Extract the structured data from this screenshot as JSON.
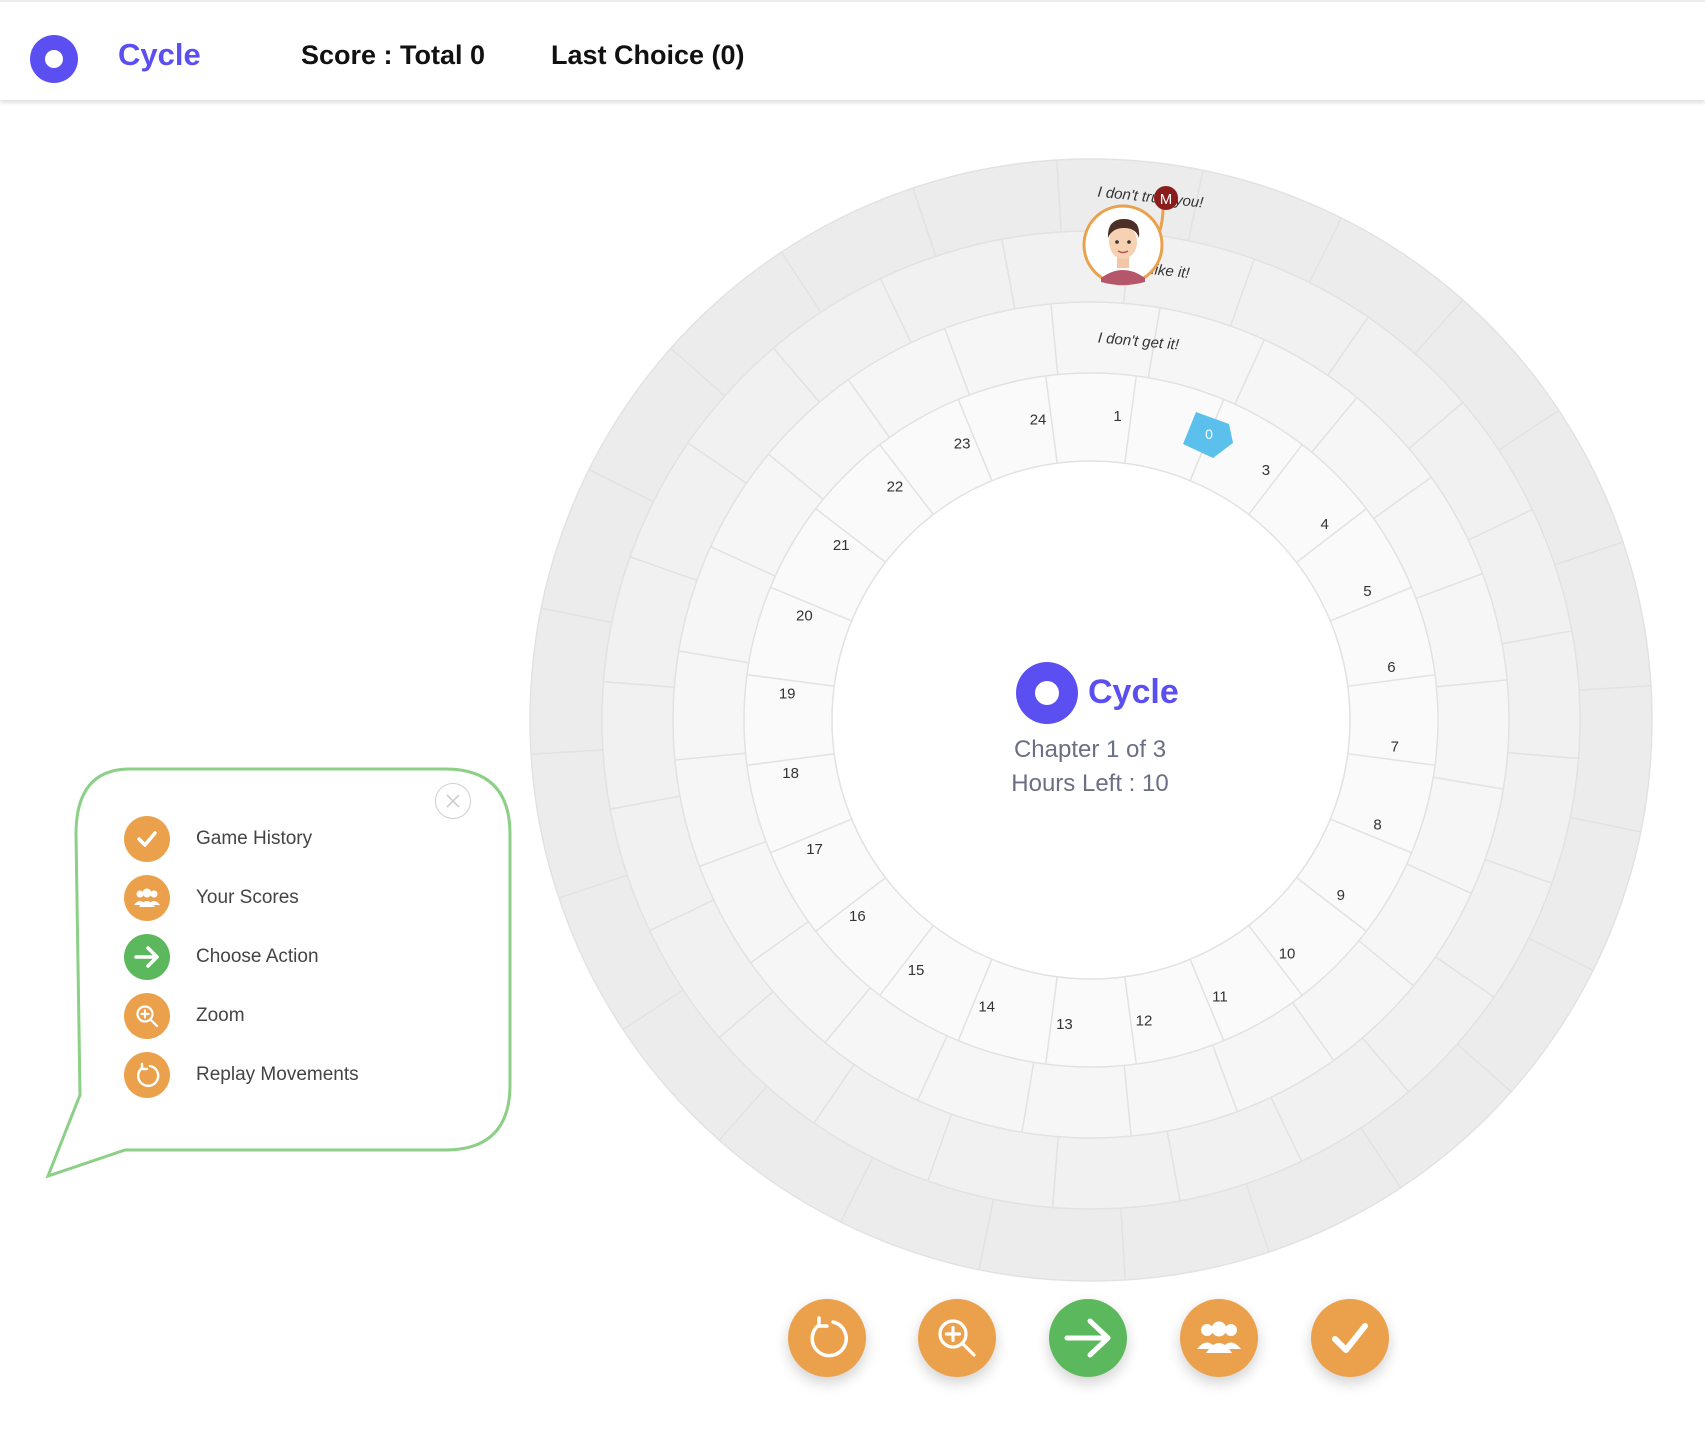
{
  "header": {
    "brand": "Cycle",
    "score_label": "Score : Total 0",
    "last_choice_label": "Last Choice (0)"
  },
  "colors": {
    "brand": "#5b4ff2",
    "orange": "#eba14b",
    "green": "#5cb85c",
    "token": "#5bc0eb"
  },
  "board": {
    "slot_numbers": [
      "1",
      "0",
      "3",
      "4",
      "5",
      "6",
      "7",
      "8",
      "9",
      "10",
      "11",
      "12",
      "13",
      "14",
      "15",
      "16",
      "17",
      "18",
      "19",
      "20",
      "21",
      "22",
      "23",
      "24"
    ],
    "ring_texts": [
      "I don't get it!",
      "like it!",
      "I don't trust you!"
    ],
    "avatar_badge": "M",
    "current_token": "0"
  },
  "center": {
    "title": "Cycle",
    "chapter": "Chapter 1 of 3",
    "hours": "Hours Left : 10"
  },
  "legend": {
    "items": [
      {
        "label": "Game History",
        "icon": "check-icon"
      },
      {
        "label": "Your Scores",
        "icon": "group-icon"
      },
      {
        "label": "Choose Action",
        "icon": "arrow-right-icon"
      },
      {
        "label": "Zoom",
        "icon": "zoom-in-icon"
      },
      {
        "label": "Replay Movements",
        "icon": "replay-icon"
      }
    ]
  },
  "toolbar": {
    "buttons": [
      {
        "name": "replay-button",
        "icon": "replay-icon"
      },
      {
        "name": "zoom-button",
        "icon": "zoom-in-icon"
      },
      {
        "name": "choose-action-button",
        "icon": "arrow-right-icon"
      },
      {
        "name": "scores-button",
        "icon": "group-icon"
      },
      {
        "name": "game-history-button",
        "icon": "check-icon"
      }
    ]
  }
}
